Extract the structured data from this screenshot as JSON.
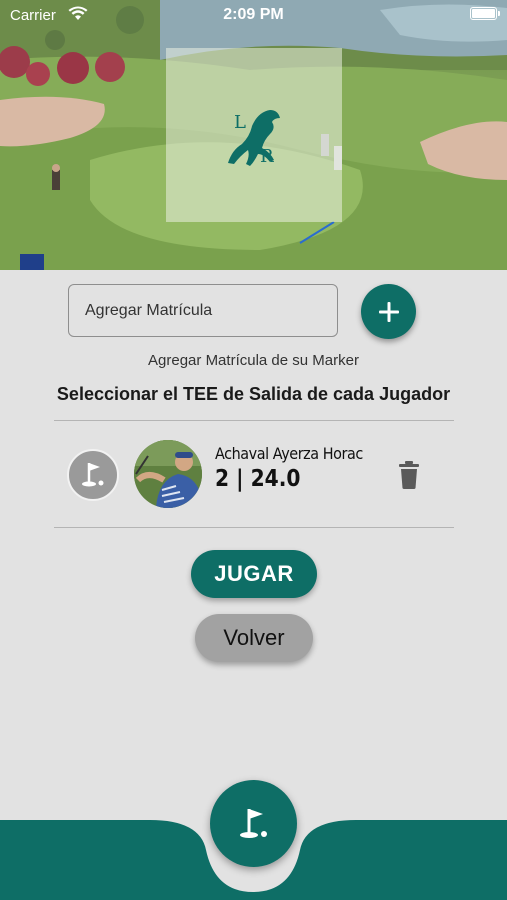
{
  "status_bar": {
    "carrier": "Carrier",
    "time": "2:09 PM"
  },
  "form": {
    "matricula_placeholder": "Agregar Matrícula",
    "add_icon": "plus-icon",
    "hint": "Agregar Matrícula de su Marker"
  },
  "section_title": "Seleccionar el TEE de Salida de cada Jugador",
  "players": [
    {
      "name": "Achaval Ayerza Horac",
      "stats": "2 | 24.0",
      "tee_icon": "golf-flag-icon",
      "delete_icon": "trash-icon"
    }
  ],
  "buttons": {
    "jugar": "JUGAR",
    "volver": "Volver"
  },
  "bottom_bar": {
    "fab_icon": "golf-flag-icon"
  },
  "colors": {
    "primary": "#0e6e66",
    "background": "#e2e2e2",
    "secondary_button": "#a2a2a2"
  }
}
